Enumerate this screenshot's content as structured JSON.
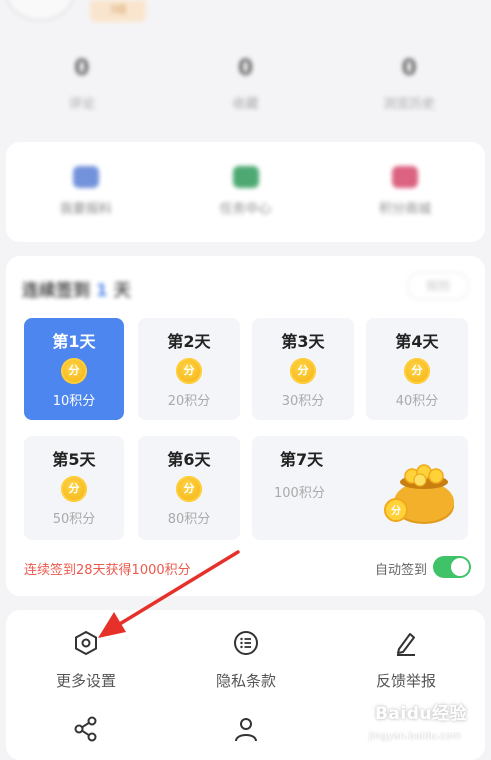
{
  "profile": {
    "level_badge": "3级"
  },
  "stats": [
    {
      "num": "0",
      "label": "评论"
    },
    {
      "num": "0",
      "label": "收藏"
    },
    {
      "num": "0",
      "label": "浏览历史"
    }
  ],
  "quick_links": [
    {
      "label": "我要报料",
      "color": "#5b7fd6"
    },
    {
      "label": "任务中心",
      "color": "#2e9a5a"
    },
    {
      "label": "积分商城",
      "color": "#d5476b"
    }
  ],
  "checkin": {
    "title_prefix": "连续签到",
    "days_count": "1",
    "title_suffix": "天",
    "rule_label": "规则",
    "days": [
      {
        "title": "第1天",
        "coin": "分",
        "points": "10积分",
        "active": true
      },
      {
        "title": "第2天",
        "coin": "分",
        "points": "20积分"
      },
      {
        "title": "第3天",
        "coin": "分",
        "points": "30积分"
      },
      {
        "title": "第4天",
        "coin": "分",
        "points": "40积分"
      },
      {
        "title": "第5天",
        "coin": "分",
        "points": "50积分"
      },
      {
        "title": "第6天",
        "coin": "分",
        "points": "80积分"
      },
      {
        "title": "第7天",
        "coin": "分",
        "points": "100积分"
      }
    ],
    "streak_text": "连续签到28天获得1000积分",
    "auto_label": "自动签到",
    "auto_enabled": true,
    "accent": "#4d86ee",
    "toggle_color": "#3fc268"
  },
  "menu": [
    {
      "label": "更多设置",
      "icon": "hexagon-settings-icon"
    },
    {
      "label": "隐私条款",
      "icon": "list-icon"
    },
    {
      "label": "反馈举报",
      "icon": "pen-icon"
    },
    {
      "label": "",
      "icon": "share-icon"
    },
    {
      "label": "",
      "icon": "user-icon"
    }
  ],
  "watermark": {
    "text": "Baidu经验",
    "sub": "jingyan.baidu.com"
  }
}
